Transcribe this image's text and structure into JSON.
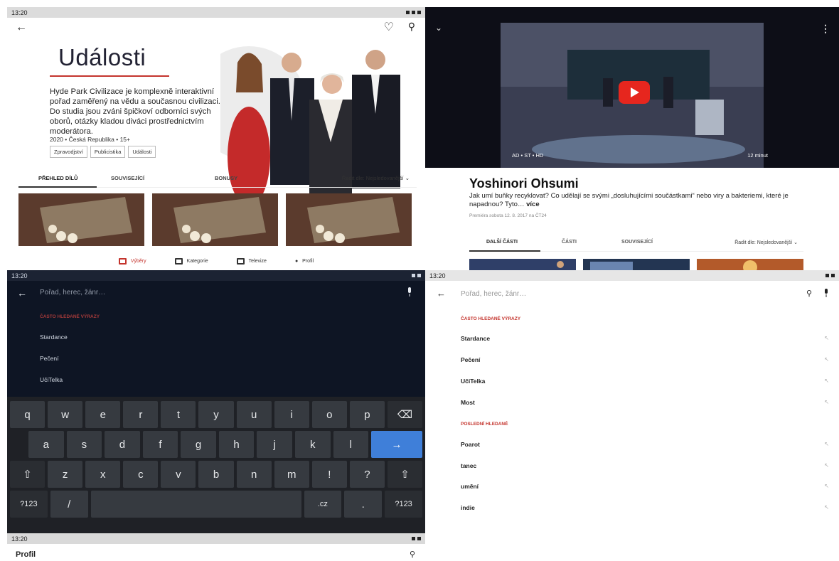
{
  "status_bar": {
    "time": "13:20"
  },
  "detail": {
    "title": "Události",
    "description": "Hyde Park Civilizace je komplexně interaktivní pořad zaměřený na vědu a současnou civilizaci. Do studia jsou zváni špičkoví odborníci svých oborů, otázky kladou diváci prostřednictvím moderátora.",
    "meta": "2020 • Česká Republika • 15+",
    "tags": [
      "Zpravodjství",
      "Publicistika",
      "Události"
    ],
    "tabs": [
      "PŘEHLED DÍLŮ",
      "SOUVISEJÍCÍ",
      "BONUSY"
    ],
    "sort_label": "Řadit dle: Nejsledovanější",
    "bottom_nav": [
      "Výběry",
      "Kategorie",
      "Televize",
      "Profil"
    ]
  },
  "player": {
    "badges": "AD • ST • HD",
    "duration": "12 minut",
    "title": "Yoshinori Ohsumi",
    "description": "Jak umí buňky recyklovat? Co udělají se svými „dosluhujícími součástkami“ nebo viry a bakteriemi, které je napadnou? Tyto…",
    "more_link": "více",
    "premiere": "Premiéra sobota 12. 8. 2017 na ČT24",
    "tabs": [
      "DALŠÍ ČÁSTI",
      "ČÁSTI",
      "SOUVISEJÍCÍ"
    ],
    "sort_label": "Řadit dle: Nejsledovanější"
  },
  "search_dark": {
    "placeholder": "Pořad, herec, žánr…",
    "section": "ČASTO HLEDANÉ VÝRAZY",
    "items": [
      "Stardance",
      "Pečení",
      "UčiTelka"
    ]
  },
  "keyboard": {
    "row1": [
      "q",
      "w",
      "e",
      "r",
      "t",
      "y",
      "u",
      "i",
      "o",
      "p",
      "⌫"
    ],
    "row2": [
      "a",
      "s",
      "d",
      "f",
      "g",
      "h",
      "j",
      "k",
      "l",
      "→"
    ],
    "row3": [
      "⇧",
      "z",
      "x",
      "c",
      "v",
      "b",
      "n",
      "m",
      "!",
      "?",
      "⇧"
    ],
    "row4": [
      "?123",
      "/",
      "",
      ".cz",
      ".",
      "?123"
    ]
  },
  "search_light": {
    "placeholder": "Pořad, herec, žánr…",
    "section_frequent": "ČASTO HLEDANÉ VÝRAZY",
    "frequent": [
      "Stardance",
      "Pečení",
      "UčiTelka",
      "Most"
    ],
    "section_recent": "POSLEDNÍ HLEDANÉ",
    "recent": [
      "Poarot",
      "tanec",
      "umění",
      "indie"
    ]
  },
  "profile": {
    "title": "Profil"
  },
  "colors": {
    "accent": "#c4342d",
    "keyboard_enter": "#3f7fd9",
    "dark_bg": "#0e1524"
  }
}
